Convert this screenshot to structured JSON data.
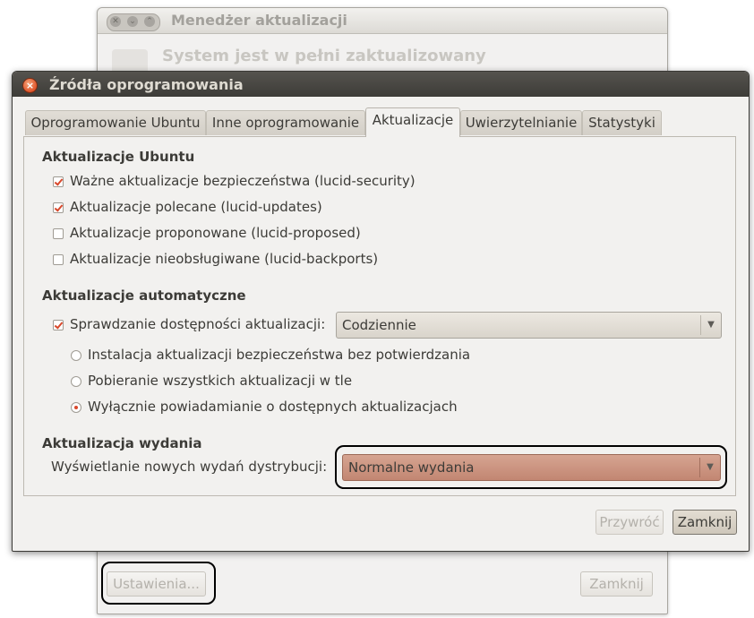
{
  "background_window": {
    "title": "Menedżer aktualizacji",
    "headline": "System jest w pełni zaktualizowany",
    "settings_button": "Ustawienia...",
    "close_button": "Zamknij"
  },
  "dialog": {
    "title": "Źródła oprogramowania",
    "tabs": [
      "Oprogramowanie Ubuntu",
      "Inne oprogramowanie",
      "Aktualizacje",
      "Uwierzytelnianie",
      "Statystyki"
    ],
    "active_tab": "Aktualizacje",
    "ubuntu_updates": {
      "heading": "Aktualizacje Ubuntu",
      "items": [
        {
          "label": "Ważne aktualizacje bezpieczeństwa (lucid-security)",
          "checked": true
        },
        {
          "label": "Aktualizacje polecane (lucid-updates)",
          "checked": true
        },
        {
          "label": "Aktualizacje proponowane (lucid-proposed)",
          "checked": false
        },
        {
          "label": "Aktualizacje nieobsługiwane (lucid-backports)",
          "checked": false
        }
      ]
    },
    "automatic_updates": {
      "heading": "Aktualizacje automatyczne",
      "check_label": "Sprawdzanie dostępności aktualizacji:",
      "check_enabled": true,
      "frequency_value": "Codziennie",
      "options": [
        {
          "label": "Instalacja aktualizacji bezpieczeństwa bez potwierdzania",
          "selected": false
        },
        {
          "label": "Pobieranie wszystkich aktualizacji w tle",
          "selected": false
        },
        {
          "label": "Wyłącznie powiadamianie o dostępnych aktualizacjach",
          "selected": true
        }
      ]
    },
    "release_upgrade": {
      "heading": "Aktualizacja wydania",
      "label": "Wyświetlanie nowych wydań dystrybucji:",
      "value": "Normalne wydania"
    },
    "buttons": {
      "revert": "Przywróć",
      "close": "Zamknij"
    }
  },
  "colors": {
    "accent": "#d8482b",
    "title_bar": "#3d3c38",
    "selected_combo": "#c89080"
  },
  "icons": [
    "close-icon",
    "minimize-icon",
    "maximize-icon",
    "dropdown-arrow-icon",
    "checkmark-icon",
    "update-manager-icon"
  ]
}
